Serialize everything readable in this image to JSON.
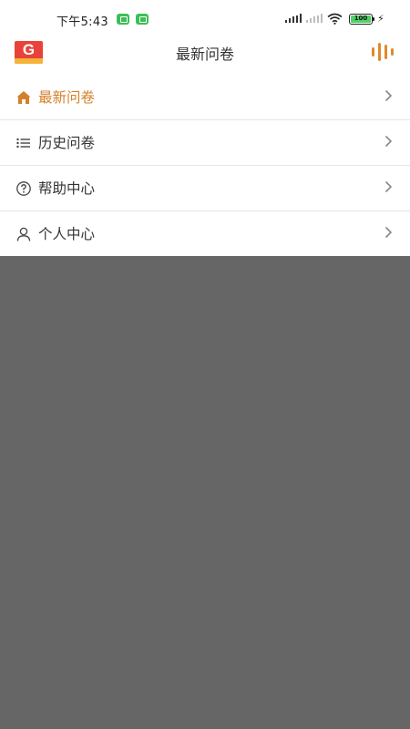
{
  "status_bar": {
    "time": "下午5:43",
    "battery": "100"
  },
  "header": {
    "title": "最新问卷"
  },
  "menu": {
    "items": [
      {
        "label": "最新问卷",
        "icon": "home-icon",
        "active": true
      },
      {
        "label": "历史问卷",
        "icon": "list-icon",
        "active": false
      },
      {
        "label": "帮助中心",
        "icon": "help-circle-icon",
        "active": false
      },
      {
        "label": "个人中心",
        "icon": "user-icon",
        "active": false
      }
    ]
  },
  "colors": {
    "accent": "#d4802a",
    "overlay": "#666666",
    "logo_red": "#e8423a"
  }
}
